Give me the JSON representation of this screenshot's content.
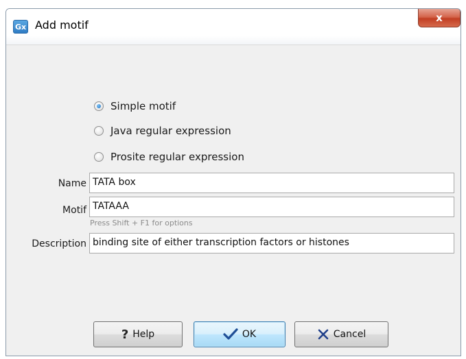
{
  "window": {
    "title": "Add motif",
    "app_icon_text": "Gx",
    "close_glyph": "x"
  },
  "motif_type": {
    "options": [
      {
        "label": "Simple motif",
        "selected": true
      },
      {
        "label": "Java regular expression",
        "selected": false
      },
      {
        "label": "Prosite regular expression",
        "selected": false
      }
    ]
  },
  "fields": {
    "name_label": "Name",
    "name_value": "TATA box",
    "motif_label": "Motif",
    "motif_value": "TATAAA",
    "motif_hint": "Press Shift + F1 for options",
    "description_label": "Description",
    "description_value": "binding site of either transcription factors or histones"
  },
  "buttons": {
    "help_label": "Help",
    "help_icon": "question-mark-icon",
    "ok_label": "OK",
    "ok_icon": "checkmark-icon",
    "cancel_label": "Cancel",
    "cancel_icon": "x-mark-icon"
  },
  "colors": {
    "accent": "#2f7cc4",
    "close": "#c94a2f",
    "checkmark": "#1f4e96",
    "cancel_x": "#1f3f8a"
  }
}
